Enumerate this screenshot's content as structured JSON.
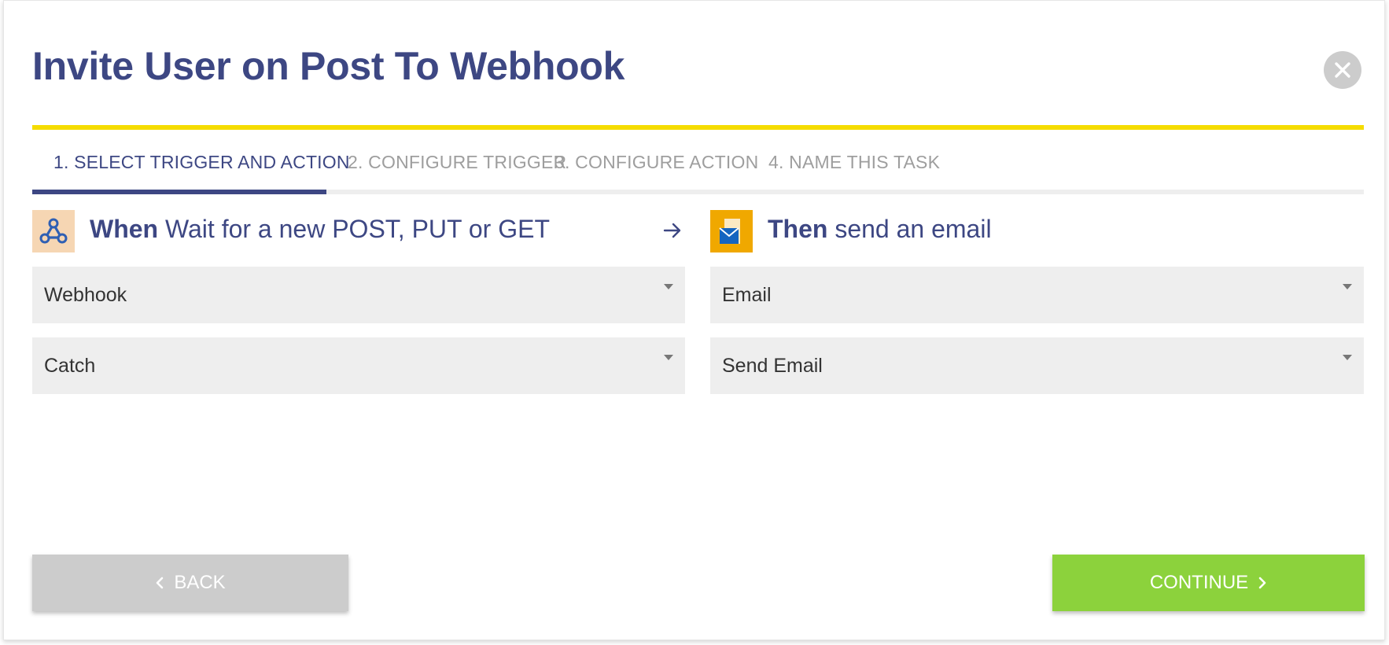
{
  "dialog": {
    "title": "Invite User on Post To Webhook"
  },
  "tabs": [
    {
      "label": "1. Select trigger and action",
      "active": true
    },
    {
      "label": "2. Configure trigger",
      "active": false
    },
    {
      "label": "3. Configure action",
      "active": false
    },
    {
      "label": "4. Name this task",
      "active": false
    }
  ],
  "trigger": {
    "keyword": "When",
    "description": "Wait for a new POST, PUT or GET",
    "icon": "webhook-icon",
    "app_value": "Webhook",
    "event_value": "Catch"
  },
  "action": {
    "keyword": "Then",
    "description": "send an email",
    "icon": "email-app-icon",
    "app_value": "Email",
    "event_value": "Send Email"
  },
  "buttons": {
    "back_label": "Back",
    "continue_label": "Continue"
  },
  "colors": {
    "primary": "#3d4783",
    "accent_bar": "#f5dc00",
    "continue": "#8cd23c",
    "back": "#cccccc",
    "select_bg": "#eeeeee"
  }
}
